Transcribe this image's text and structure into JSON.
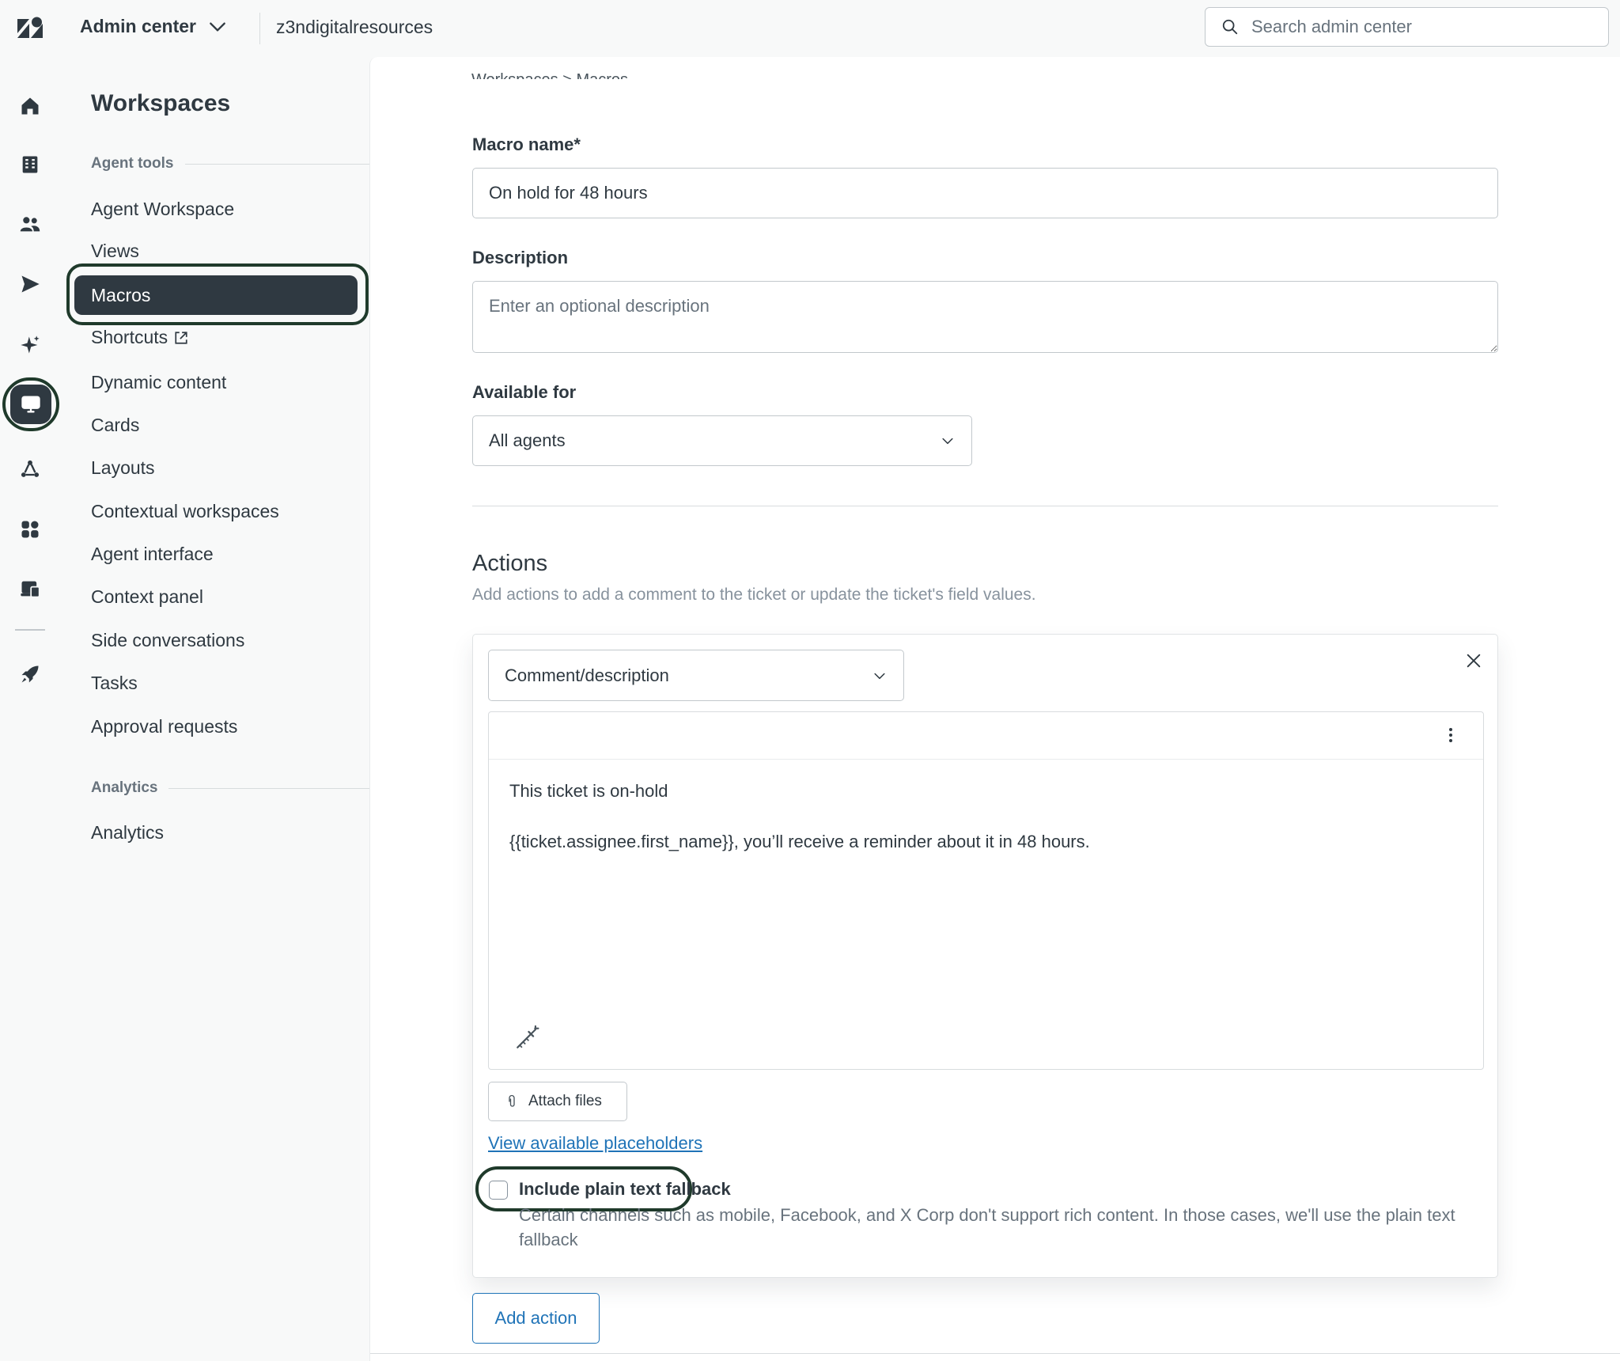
{
  "header": {
    "product_name": "Admin center",
    "account_name": "z3ndigitalresources",
    "search_placeholder": "Search admin center"
  },
  "rail": {
    "items": [
      {
        "name": "home-icon"
      },
      {
        "name": "building-icon"
      },
      {
        "name": "people-icon"
      },
      {
        "name": "send-icon"
      },
      {
        "name": "sparkle-icon"
      },
      {
        "name": "workspaces-icon",
        "active": true
      },
      {
        "name": "objects-icon"
      },
      {
        "name": "apps-icon"
      },
      {
        "name": "account-icon"
      },
      {
        "name": "rocket-icon"
      }
    ]
  },
  "nav": {
    "title": "Workspaces",
    "sections": [
      {
        "label": "Agent tools",
        "items": [
          {
            "label": "Agent Workspace"
          },
          {
            "label": "Views"
          },
          {
            "label": "Macros",
            "active": true
          },
          {
            "label": "Shortcuts",
            "external": true
          },
          {
            "label": "Dynamic content"
          },
          {
            "label": "Cards"
          },
          {
            "label": "Layouts"
          },
          {
            "label": "Contextual workspaces"
          },
          {
            "label": "Agent interface"
          },
          {
            "label": "Context panel"
          },
          {
            "label": "Side conversations"
          },
          {
            "label": "Tasks"
          },
          {
            "label": "Approval requests"
          }
        ]
      },
      {
        "label": "Analytics",
        "items": [
          {
            "label": "Analytics"
          }
        ]
      }
    ]
  },
  "form": {
    "breadcrumb_cut": "Workspaces > Macros",
    "macro_name": {
      "label": "Macro name*",
      "value": "On hold for 48 hours"
    },
    "description": {
      "label": "Description",
      "placeholder": "Enter an optional description"
    },
    "available_for": {
      "label": "Available for",
      "value": "All agents"
    }
  },
  "actions": {
    "title": "Actions",
    "description": "Add actions to add a comment to the ticket or update the ticket's field values.",
    "action_type": "Comment/description",
    "comment_lines": [
      "This ticket is on-hold",
      "{{ticket.assignee.first_name}}, you’ll receive a reminder about it in 48 hours."
    ],
    "attach_label": "Attach files",
    "placeholders_link": "View available placeholders",
    "fallback_label": "Include plain text fallback",
    "fallback_checked": false,
    "fallback_hint": "Certain channels such as mobile, Facebook, and X Corp don't support rich content. In those cases, we'll use the plain text fallback",
    "add_action_label": "Add action"
  },
  "colors": {
    "accent": "#1f73b7",
    "dark": "#2f3941",
    "highlight_ring": "#1f3a2b"
  }
}
